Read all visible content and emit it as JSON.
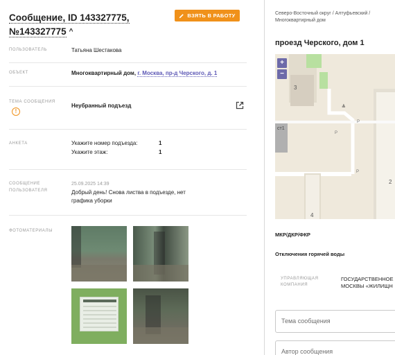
{
  "header": {
    "title_line1": "Сообщение, ID 143327775,",
    "title_line2": "№143327775",
    "take_button": "ВЗЯТЬ В РАБОТУ"
  },
  "fields": {
    "user_label": "ПОЛЬЗОВАТЕЛЬ",
    "user_value": "Татьяна Шестакова",
    "object_label": "ОБЪЕКТ",
    "object_type": "Многоквартирный дом,",
    "object_link": "г. Москва, пр-д Черского, д. 1",
    "topic_label": "ТЕМА СООБЩЕНИЯ",
    "topic_value": "Неубранный подъезд",
    "survey_label": "АНКЕТА",
    "survey_q1": "Укажите номер подъезда:",
    "survey_a1": "1",
    "survey_q2": "Укажите этаж:",
    "survey_a2": "1",
    "msg_label_1": "СООБЩЕНИЕ",
    "msg_label_2": "ПОЛЬЗОВАТЕЛЯ",
    "msg_date": "25.09.2025 14:39",
    "msg_line1": "Добрый день! Снова листва в подъезде, нет",
    "msg_line2": "графика уборки",
    "photos_label": "ФОТОМАТЕРИАЛЫ"
  },
  "right": {
    "breadcrumb_line1": "Северо-Восточный округ / Алтуфьевский /",
    "breadcrumb_line2": "Многоквартирный дом",
    "address": "проезд Черского, дом 1",
    "map": {
      "zoom_in": "+",
      "zoom_out": "−",
      "label_3": "3",
      "label_ct1": "ст1",
      "label_4": "4",
      "label_2": "2",
      "label_p": "P"
    },
    "section1": "МКР/ДКР/ФКР",
    "section2": "Отключения горячей воды",
    "mgmt_label_1": "УПРАВЛЯЮЩАЯ",
    "mgmt_label_2": "КОМПАНИЯ",
    "mgmt_value_1": "ГОСУДАРСТВЕННОЕ",
    "mgmt_value_2": "МОСКВЫ «ЖИЛИЩН",
    "input_topic_placeholder": "Тема сообщения",
    "input_author_placeholder": "Автор сообщения"
  },
  "colors": {
    "accent_orange": "#f0911a",
    "link_purple": "#5c57b5",
    "map_button": "#6d6aa9"
  }
}
